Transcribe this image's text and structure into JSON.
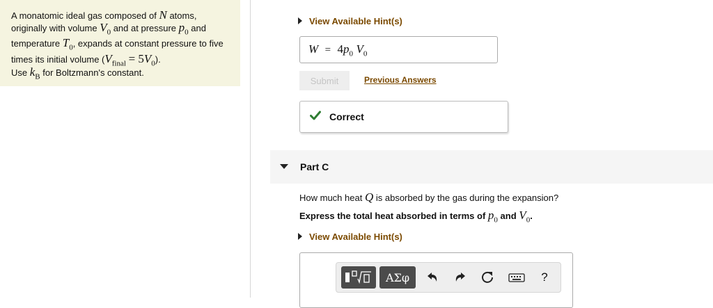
{
  "problem": {
    "p1": "A monatomic ideal gas composed of",
    "p2": "atoms, originally with volume",
    "p3": "and at pressure",
    "p4": "and temperature",
    "p5": ", expands at constant pressure to five times its initial volume (",
    "p6": ").",
    "N": "N",
    "V": "V",
    "p": "p",
    "T": "T",
    "zero": "0",
    "final": "final",
    "eq_rhs": "= 5",
    "kb_pre": "Use",
    "k": "k",
    "B": "B",
    "kb_post": "for Boltzmann's constant."
  },
  "part_b": {
    "hint_label": "View Available Hint(s)",
    "answer_lhs": "W",
    "answer_eq": "=",
    "answer_coef": "4",
    "answer_p": "p",
    "answer_V": "V",
    "answer_sub": "0",
    "submit_label": "Submit",
    "previous_answers_label": "Previous Answers",
    "feedback_label": "Correct"
  },
  "part_c": {
    "title": "Part C",
    "q1": "How much heat",
    "Q": "Q",
    "q2": "is absorbed by the gas during the expansion?",
    "e1": "Express the total heat absorbed in terms of",
    "e_p": "p",
    "e_sub": "0",
    "e_and": "and",
    "e_V": "V",
    "e_end": ".",
    "hint_label": "View Available Hint(s)"
  },
  "toolbar": {
    "greek_label": "ΑΣφ",
    "help_label": "?",
    "icons": [
      "templates-icon",
      "undo-icon",
      "redo-icon",
      "reset-icon",
      "keyboard-icon",
      "help-icon"
    ]
  },
  "colors": {
    "panel_bg": "#f5f4e0",
    "link": "#7b4a00",
    "correct_green": "#2e7d32",
    "toolbar_dark": "#4b4b4b"
  }
}
